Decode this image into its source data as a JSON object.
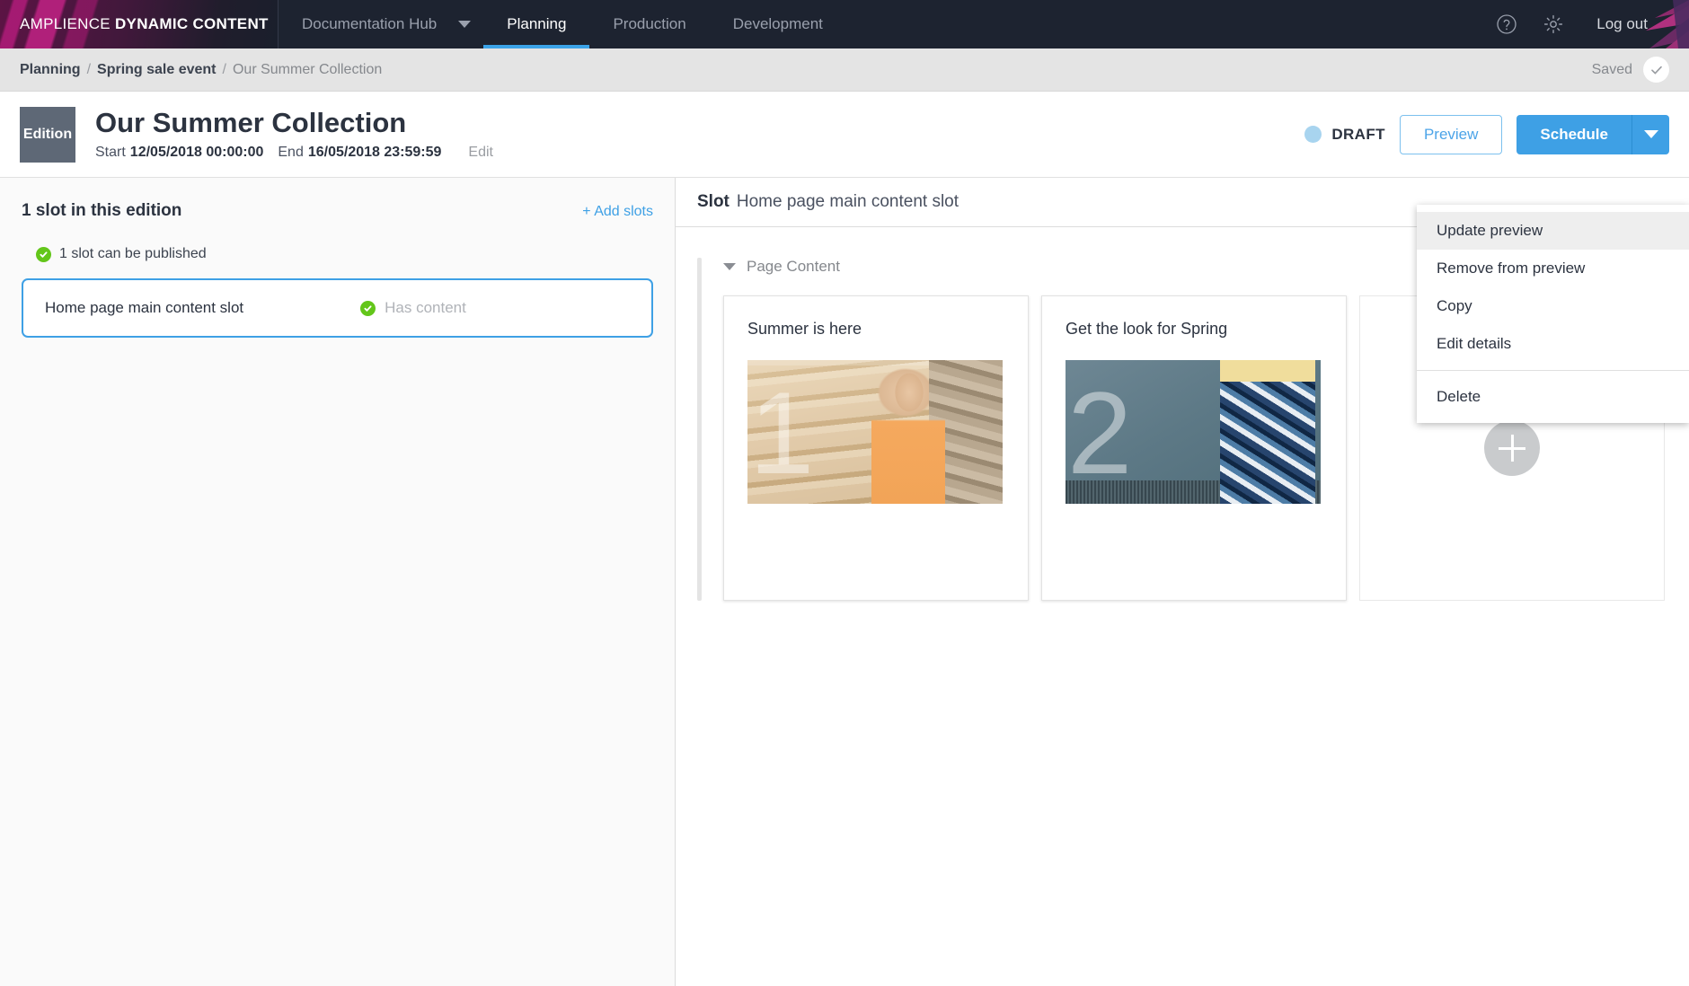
{
  "topnav": {
    "brand_light": "AMPLIENCE ",
    "brand_bold": "DYNAMIC CONTENT",
    "hub_label": "Documentation Hub",
    "items": [
      {
        "label": "Planning",
        "active": true
      },
      {
        "label": "Production",
        "active": false
      },
      {
        "label": "Development",
        "active": false
      }
    ],
    "help_icon": "question-circle-icon",
    "settings_icon": "gear-icon",
    "logout_label": "Log out"
  },
  "breadcrumb": {
    "items": [
      {
        "label": "Planning",
        "current": false
      },
      {
        "label": "Spring sale event",
        "current": false
      },
      {
        "label": "Our Summer Collection",
        "current": true
      }
    ],
    "separator": "/",
    "saved_label": "Saved",
    "saved_icon": "check-circle-icon"
  },
  "edition": {
    "badge": "Edition",
    "title": "Our Summer Collection",
    "start_label": "Start",
    "start_value": "12/05/2018 00:00:00",
    "end_label": "End",
    "end_value": "16/05/2018 23:59:59",
    "edit_label": "Edit",
    "status": "DRAFT",
    "status_color": "#a8d4ef",
    "preview_label": "Preview",
    "schedule_label": "Schedule",
    "accent_color": "#3ea0e5"
  },
  "menu": {
    "items": [
      {
        "label": "Update preview",
        "highlighted": true
      },
      {
        "label": "Remove from preview",
        "highlighted": false
      },
      {
        "label": "Copy",
        "highlighted": false
      },
      {
        "label": "Edit details",
        "highlighted": false
      },
      {
        "label": "Delete",
        "highlighted": false
      }
    ]
  },
  "left_pane": {
    "title": "1 slot in this edition",
    "add_slots_label": "+ Add slots",
    "publish_status": "1 slot can be published",
    "slot": {
      "name": "Home page main content slot",
      "status": "Has content"
    }
  },
  "right_pane": {
    "slot_label": "Slot",
    "slot_name": "Home page main content slot",
    "group_label": "Page Content",
    "cards": [
      {
        "title": "Summer is here",
        "numeral": "1",
        "photo": "photo1"
      },
      {
        "title": "Get the look for Spring",
        "numeral": "2",
        "photo": "photo2"
      }
    ],
    "add_card_icon": "plus-icon"
  }
}
